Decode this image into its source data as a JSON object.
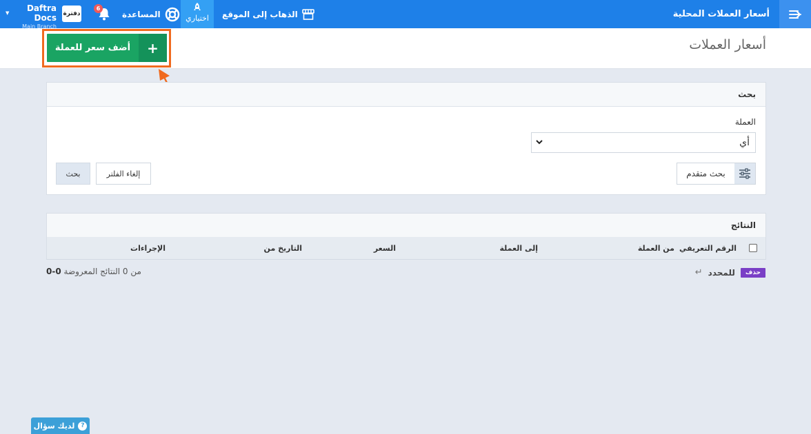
{
  "topbar": {
    "page_name": "أسعار العملات المحلية",
    "go_to_site": "الذهاب إلى الموقع",
    "optional": "اختياري",
    "help": "المساعدة",
    "notifications_count": "6",
    "logo_text": "دفترة",
    "account_name": "Daftra Docs",
    "branch_name": "Main Branch"
  },
  "header": {
    "title": "أسعار العملات",
    "add_button": "أضف سعر للعملة",
    "add_icon": "+"
  },
  "search": {
    "panel_title": "بحث",
    "currency_label": "العملة",
    "currency_value": "أي",
    "advanced_search": "بحث متقدم",
    "clear_filter": "إلغاء الفلتر",
    "search_button": "بحث"
  },
  "results": {
    "panel_title": "النتائج",
    "columns": {
      "id": "الرقم التعريفي",
      "from_currency": "من العملة",
      "to_currency": "إلى العملة",
      "rate": "السعر",
      "date_from": "التاريخ من",
      "actions": "الإجراءات"
    },
    "count_range": "0-0",
    "count_text": "من 0 النتائج المعروضة",
    "bulk_label": "للمحدد",
    "bulk_corner": "↵",
    "delete_label": "حذف"
  },
  "help_widget": {
    "label": "لديك سؤال",
    "icon_glyph": "?"
  },
  "colors": {
    "topbar": "#1e80e8",
    "primary_green": "#1aa463",
    "highlight_orange": "#f06a1e",
    "delete_purple": "#7a3fc6"
  }
}
